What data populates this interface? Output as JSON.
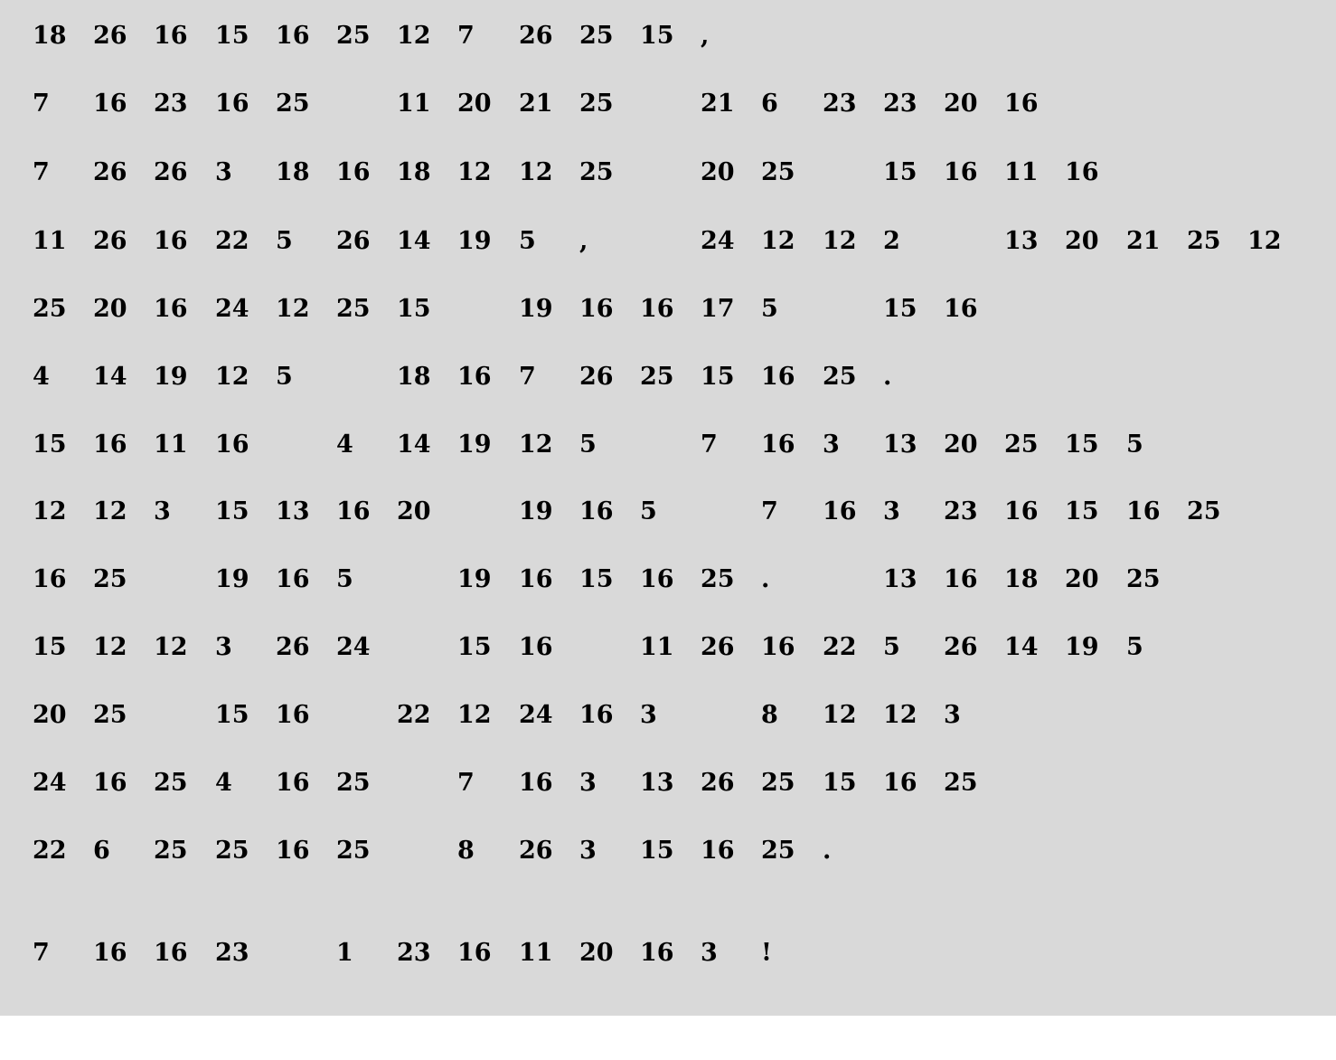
{
  "colors": {
    "panel_background": "#d9d9d9",
    "page_background": "#ffffff",
    "text": "#000000"
  },
  "rows": [
    [
      "18",
      "26",
      "16",
      "15",
      "16",
      "25",
      "12",
      "7",
      "26",
      "25",
      "15",
      ","
    ],
    [
      "7",
      "16",
      "23",
      "16",
      "25",
      "",
      "11",
      "20",
      "21",
      "25",
      "",
      "21",
      "6",
      "23",
      "23",
      "20",
      "16"
    ],
    [
      "7",
      "26",
      "26",
      "3",
      "18",
      "16",
      "18",
      "12",
      "12",
      "25",
      "",
      "20",
      "25",
      "",
      "15",
      "16",
      "11",
      "16"
    ],
    [
      "11",
      "26",
      "16",
      "22",
      "5",
      "26",
      "14",
      "19",
      "5",
      ",",
      "",
      "24",
      "12",
      "12",
      "2",
      "",
      "13",
      "20",
      "21",
      "25",
      "12"
    ],
    [
      "25",
      "20",
      "16",
      "24",
      "12",
      "25",
      "15",
      "",
      "19",
      "16",
      "16",
      "17",
      "5",
      "",
      "15",
      "16"
    ],
    [
      "4",
      "14",
      "19",
      "12",
      "5",
      "",
      "18",
      "16",
      "7",
      "26",
      "25",
      "15",
      "16",
      "25",
      "."
    ],
    [
      "15",
      "16",
      "11",
      "16",
      "",
      "4",
      "14",
      "19",
      "12",
      "5",
      "",
      "7",
      "16",
      "3",
      "13",
      "20",
      "25",
      "15",
      "5"
    ],
    [
      "12",
      "12",
      "3",
      "15",
      "13",
      "16",
      "20",
      "",
      "19",
      "16",
      "5",
      "",
      "7",
      "16",
      "3",
      "23",
      "16",
      "15",
      "16",
      "25"
    ],
    [
      "16",
      "25",
      "",
      "19",
      "16",
      "5",
      "",
      "19",
      "16",
      "15",
      "16",
      "25",
      ".",
      "",
      "13",
      "16",
      "18",
      "20",
      "25"
    ],
    [
      "15",
      "12",
      "12",
      "3",
      "26",
      "24",
      "",
      "15",
      "16",
      "",
      "11",
      "26",
      "16",
      "22",
      "5",
      "26",
      "14",
      "19",
      "5"
    ],
    [
      "20",
      "25",
      "",
      "15",
      "16",
      "",
      "22",
      "12",
      "24",
      "16",
      "3",
      "",
      "8",
      "12",
      "12",
      "3"
    ],
    [
      "24",
      "16",
      "25",
      "4",
      "16",
      "25",
      "",
      "7",
      "16",
      "3",
      "13",
      "26",
      "25",
      "15",
      "16",
      "25"
    ],
    [
      "22",
      "6",
      "25",
      "25",
      "16",
      "25",
      "",
      "8",
      "26",
      "3",
      "15",
      "16",
      "25",
      "."
    ],
    [
      "7",
      "16",
      "16",
      "23",
      "",
      "1",
      "23",
      "16",
      "11",
      "20",
      "16",
      "3",
      "!"
    ]
  ]
}
